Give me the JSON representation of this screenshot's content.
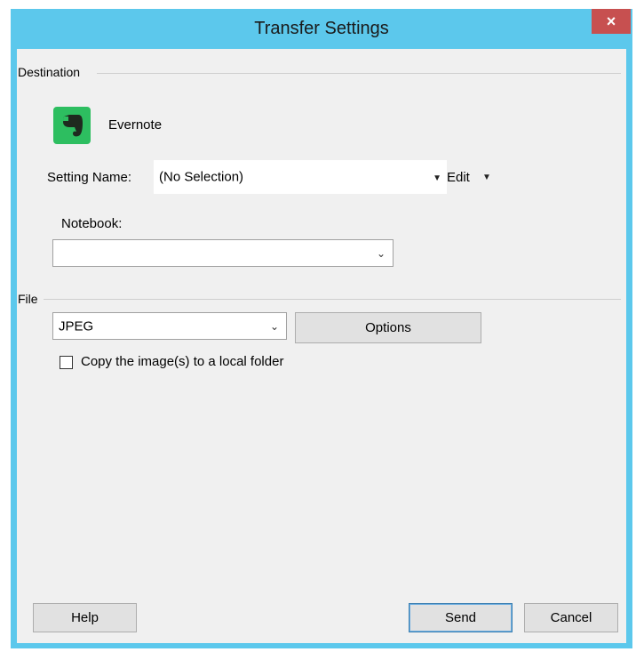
{
  "window": {
    "title": "Transfer Settings",
    "close_glyph": "×"
  },
  "destination": {
    "group_label": "Destination",
    "app_name": "Evernote",
    "app_icon": "evernote-elephant-icon",
    "setting_name_label": "Setting Name:",
    "setting_name_value": "(No Selection)",
    "edit_label": "Edit",
    "notebook_label": "Notebook:",
    "notebook_value": ""
  },
  "file": {
    "group_label": "File",
    "format_value": "JPEG",
    "options_label": "Options",
    "copy_local_label": "Copy the image(s) to a local folder",
    "copy_local_checked": false
  },
  "buttons": {
    "help": "Help",
    "send": "Send",
    "cancel": "Cancel"
  },
  "colors": {
    "titlebar": "#5cc8ec",
    "close": "#c75050",
    "evernote": "#2dbe60"
  }
}
